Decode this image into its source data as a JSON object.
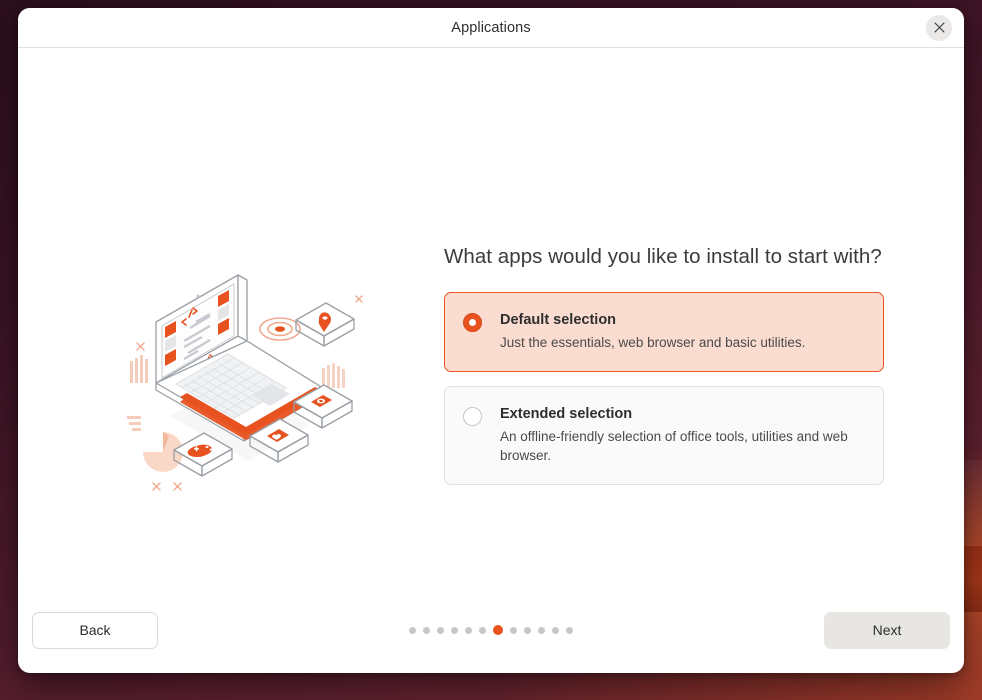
{
  "window": {
    "title": "Applications",
    "close_icon": "close-icon"
  },
  "main": {
    "heading": "What apps would you like to install to start with?",
    "illustration_name": "laptop-apps-isometric-illustration",
    "options": [
      {
        "title": "Default selection",
        "description": "Just the essentials, web browser and basic utilities.",
        "selected": true
      },
      {
        "title": "Extended selection",
        "description": "An offline-friendly selection of office tools, utilities and web browser.",
        "selected": false
      }
    ]
  },
  "footer": {
    "back_label": "Back",
    "next_label": "Next",
    "pagination": {
      "total": 12,
      "active_index": 7
    }
  },
  "colors": {
    "accent": "#e8521f",
    "selected_card_bg": "#fadcd0",
    "selected_card_border": "#e8552b",
    "unselected_card_bg": "#fafafa",
    "unselected_card_border": "#e4e2e0",
    "next_button_bg": "#e8e6e3",
    "heading_text": "#3b3b3b",
    "desktop_bg": "#4d1a2b"
  }
}
